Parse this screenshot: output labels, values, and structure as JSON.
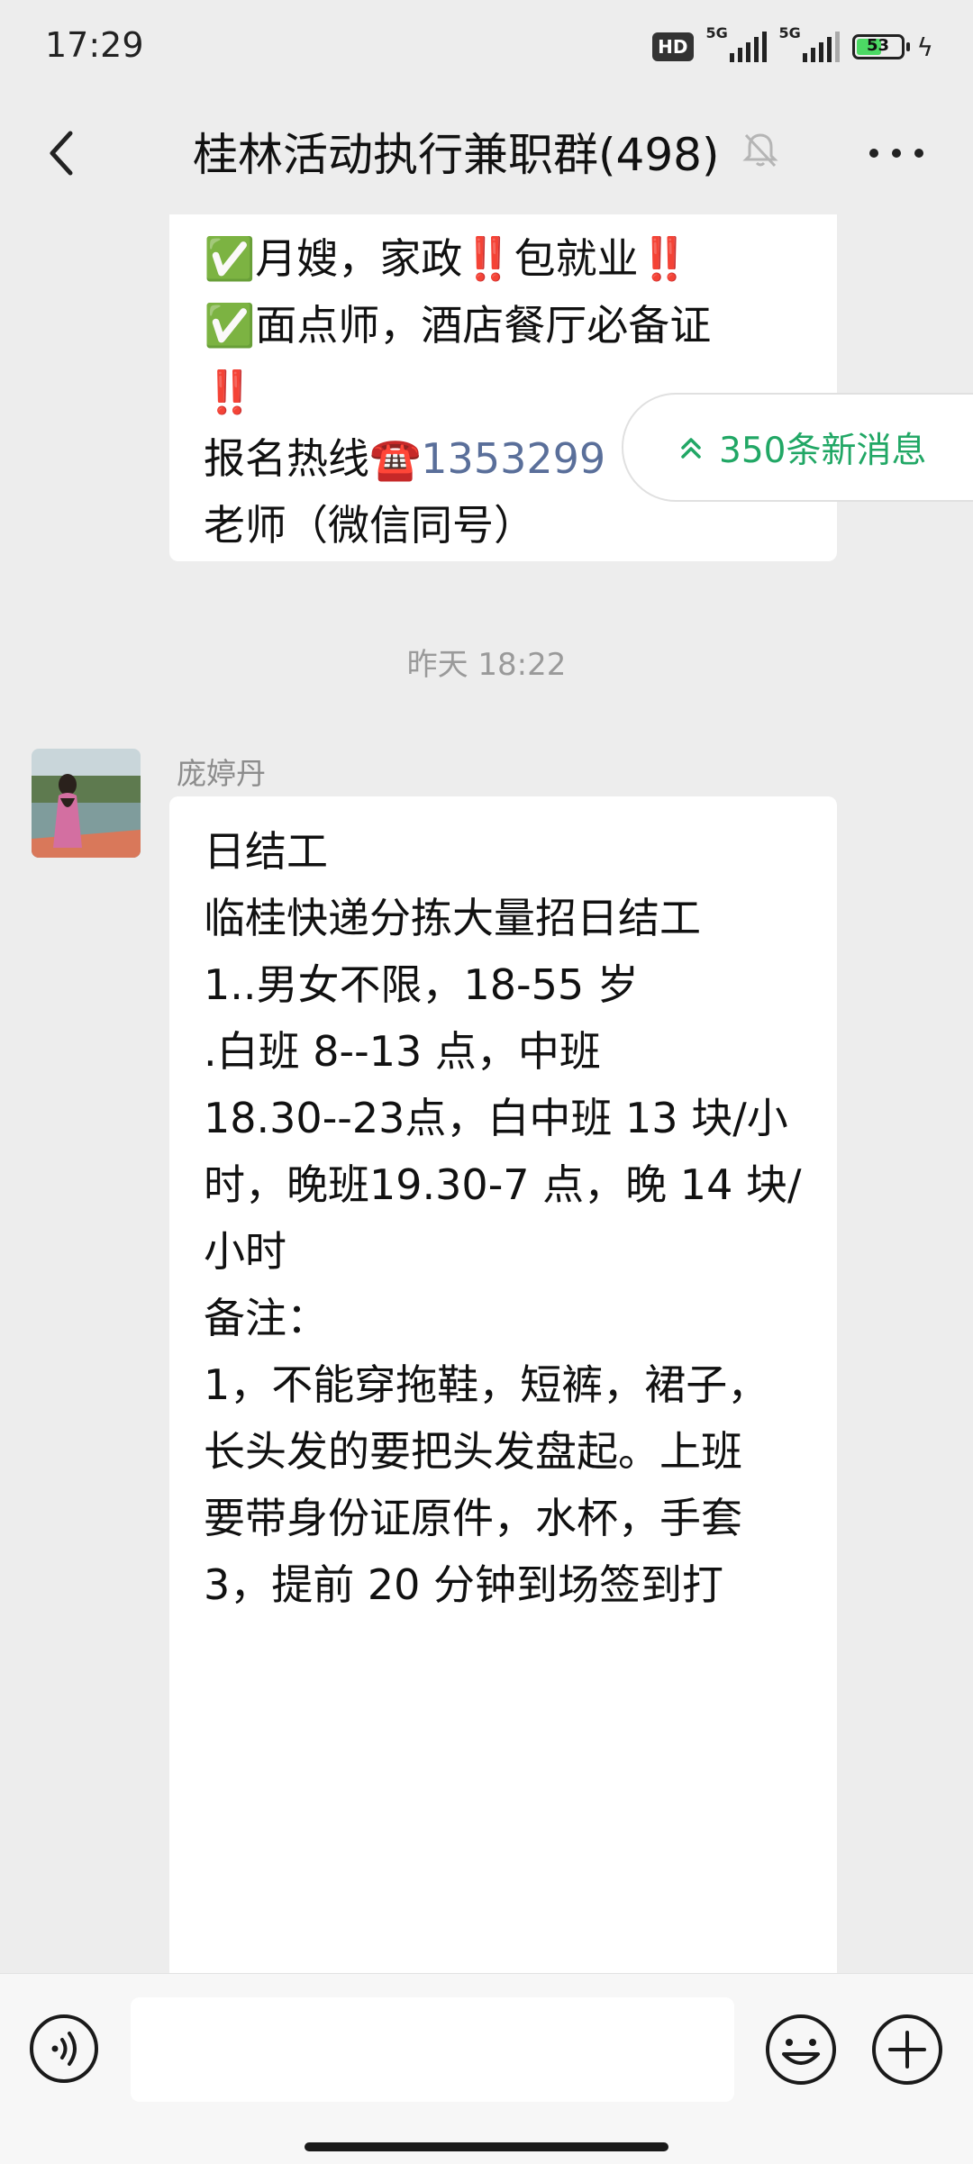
{
  "status_bar": {
    "time": "17:29",
    "hd_label": "HD",
    "signal1_label": "5G",
    "signal2_label": "5G",
    "battery_level": "53"
  },
  "nav": {
    "title": "桂林活动执行兼职群(498)"
  },
  "messages": {
    "prev_lines": [
      "✅月嫂，家政‼️包就业‼️",
      "✅面点师，酒店餐厅必备证",
      "‼️"
    ],
    "prev_hotline_label": "报名热线☎️",
    "prev_hotline_number": "1353299",
    "prev_last_line": "老师（微信同号）",
    "timestamp": "昨天 18:22",
    "sender_name": "庞婷丹",
    "body_lines": [
      "日结工",
      "",
      "临桂快递分拣大量招日结工",
      "",
      "1..男女不限，18-55 岁",
      ".白班 8--13 点，中班",
      "18.30--23点，白中班 13 块/小",
      "时，晚班19.30-7 点，晚 14 块/",
      "小时",
      "",
      "",
      "备注：",
      "1，不能穿拖鞋，短裤，裙子，",
      "长头发的要把头发盘起。上班",
      "要带身份证原件，水杯，手套",
      "",
      "3，提前 20 分钟到场签到打"
    ]
  },
  "new_messages_pill": {
    "label": "350条新消息"
  },
  "colors": {
    "accent_green": "#21a765",
    "link_blue": "#5a6f9a"
  }
}
